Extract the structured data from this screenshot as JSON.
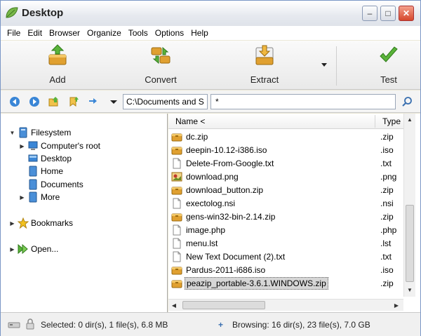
{
  "window": {
    "title": "Desktop"
  },
  "menu": [
    "File",
    "Edit",
    "Browser",
    "Organize",
    "Tools",
    "Options",
    "Help"
  ],
  "toolbar": {
    "add_label": "Add",
    "convert_label": "Convert",
    "extract_label": "Extract",
    "test_label": "Test"
  },
  "address": {
    "path": "C:\\Documents and S",
    "filter": "*"
  },
  "tree": {
    "filesystem": "Filesystem",
    "computers_root": "Computer's root",
    "desktop": "Desktop",
    "home": "Home",
    "documents": "Documents",
    "more": "More",
    "bookmarks": "Bookmarks",
    "open": "Open..."
  },
  "filelist": {
    "col_name": "Name <",
    "col_type": "Type",
    "files": [
      {
        "name": "dc.zip",
        "type": ".zip",
        "icon": "archive-icon"
      },
      {
        "name": "deepin-10.12-i386.iso",
        "type": ".iso",
        "icon": "archive-icon"
      },
      {
        "name": "Delete-From-Google.txt",
        "type": ".txt",
        "icon": "document-icon"
      },
      {
        "name": "download.png",
        "type": ".png",
        "icon": "image-icon"
      },
      {
        "name": "download_button.zip",
        "type": ".zip",
        "icon": "archive-icon"
      },
      {
        "name": "exectolog.nsi",
        "type": ".nsi",
        "icon": "document-icon"
      },
      {
        "name": "gens-win32-bin-2.14.zip",
        "type": ".zip",
        "icon": "archive-icon"
      },
      {
        "name": "image.php",
        "type": ".php",
        "icon": "document-icon"
      },
      {
        "name": "menu.lst",
        "type": ".lst",
        "icon": "document-icon"
      },
      {
        "name": "New Text Document (2).txt",
        "type": ".txt",
        "icon": "document-icon"
      },
      {
        "name": "Pardus-2011-i686.iso",
        "type": ".iso",
        "icon": "archive-icon"
      },
      {
        "name": "peazip_portable-3.6.1.WINDOWS.zip",
        "type": ".zip",
        "icon": "archive-icon",
        "selected": true
      }
    ]
  },
  "status": {
    "selected": "Selected: 0 dir(s), 1 file(s), 6.8 MB",
    "browsing": "Browsing: 16 dir(s), 23 file(s), 7.0 GB"
  }
}
